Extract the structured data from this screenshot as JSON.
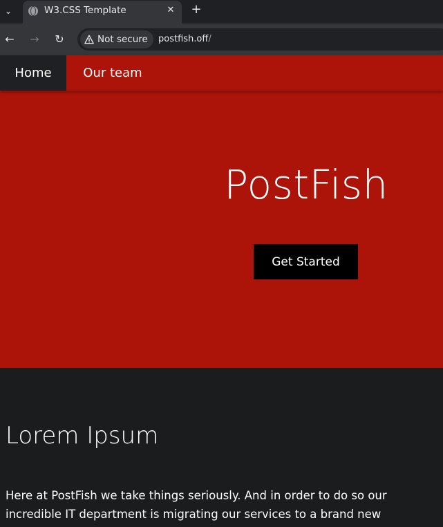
{
  "browser": {
    "tab": {
      "title": "W3.CSS Template",
      "close_glyph": "✕",
      "favicon": "globe-icon"
    },
    "new_tab_glyph": "+",
    "tab_menu_glyph": "⌄",
    "nav": {
      "back_glyph": "←",
      "forward_glyph": "→",
      "reload_glyph": "↻"
    },
    "security_label": "Not secure",
    "url_host": "postfish.off",
    "url_path": "/"
  },
  "site": {
    "nav": {
      "home": "Home",
      "team": "Our team"
    },
    "hero": {
      "title": "PostFish",
      "cta": "Get Started"
    },
    "section": {
      "title": "Lorem Ipsum",
      "body": "Here at PostFish we take things seriously. And in order to do so our incredible IT department is migrating our services to a brand new"
    }
  },
  "colors": {
    "brand_red": "#ac1409",
    "page_bg": "#1b1c1e",
    "cta_bg": "#000000"
  }
}
